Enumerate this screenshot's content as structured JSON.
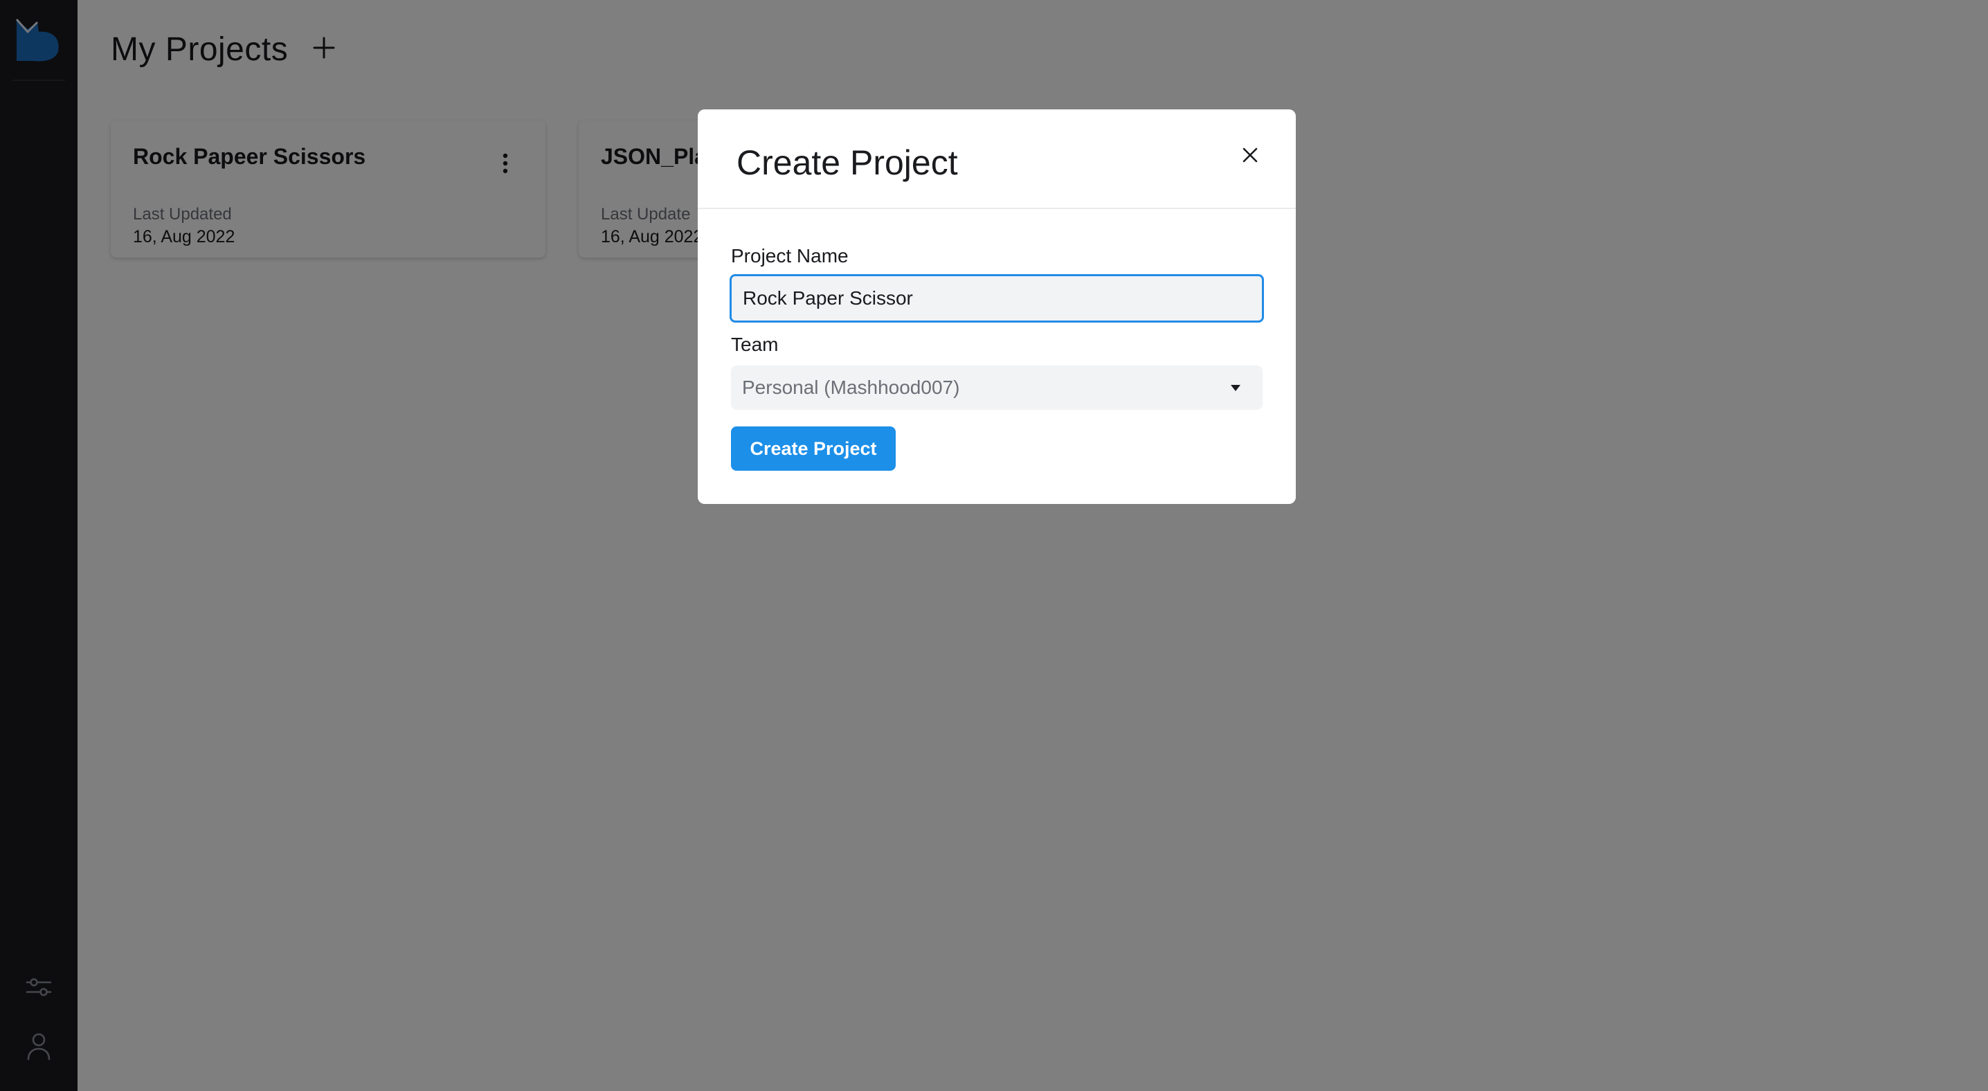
{
  "sidebar": {
    "logo_icon": "cat-logo-icon",
    "items": [
      {
        "name": "settings",
        "icon": "sliders-icon"
      },
      {
        "name": "profile",
        "icon": "user-icon"
      }
    ]
  },
  "header": {
    "title": "My Projects",
    "add_icon": "plus-icon"
  },
  "projects": [
    {
      "title": "Rock Papeer Scissors",
      "updated_label": "Last Updated",
      "updated_date": "16, Aug 2022"
    },
    {
      "title": "JSON_Pla",
      "updated_label": "Last Update",
      "updated_date": "16, Aug 2022"
    }
  ],
  "modal": {
    "title": "Create Project",
    "close_icon": "close-icon",
    "name_label": "Project Name",
    "name_value": "Rock Paper Scissor",
    "team_label": "Team",
    "team_value": "Personal (Mashhood007)",
    "submit_label": "Create Project"
  },
  "colors": {
    "sidebar_bg": "#1a1b1e",
    "accent": "#1c8fe8",
    "focus_border": "#228be6",
    "overlay": "rgba(0,0,0,0.5)"
  }
}
